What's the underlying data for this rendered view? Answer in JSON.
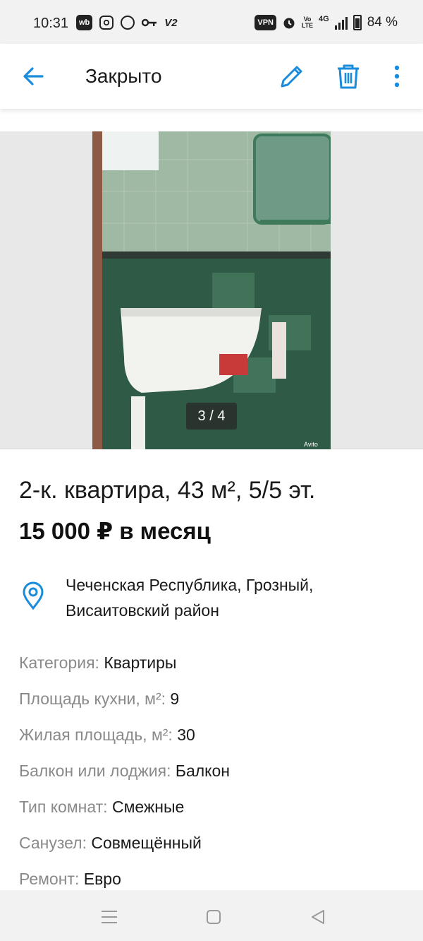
{
  "status_bar": {
    "time": "10:31",
    "left_icons": [
      "wb",
      "instagram-icon",
      "circle-icon",
      "key-icon",
      "V2"
    ],
    "right_icons": [
      "VPN",
      "alarm-icon",
      "Vo LTE",
      "4G",
      "signal-icon",
      "battery-icon"
    ],
    "vpn": "VPN",
    "battery": "84 %",
    "wb": "wb",
    "v2": "V2",
    "volte": "Vo LTE",
    "net": "4G"
  },
  "app_bar": {
    "title": "Закрыто",
    "accent": "#1a8cdb",
    "icons": [
      "back-arrow-icon",
      "pencil-icon",
      "trash-icon",
      "more-vert-icon"
    ]
  },
  "gallery": {
    "counter": "3 / 4",
    "watermark": "Avito"
  },
  "listing": {
    "title": "2-к. квартира, 43 м², 5/5 эт.",
    "price": "15 000 ₽ в месяц",
    "address": "Чеченская Республика, Грозный, Висаитовский район"
  },
  "attributes": [
    {
      "key": "Категория:",
      "value": "Квартиры"
    },
    {
      "key": "Площадь кухни, м²:",
      "value": "9"
    },
    {
      "key": "Жилая площадь, м²:",
      "value": "30"
    },
    {
      "key": "Балкон или лоджия:",
      "value": "Балкон"
    },
    {
      "key": "Тип комнат:",
      "value": "Смежные"
    },
    {
      "key": "Санузел:",
      "value": "Совмещённый"
    },
    {
      "key": "Ремонт:",
      "value": "Евро"
    }
  ],
  "nav_bar": {
    "icons": [
      "menu-icon",
      "home-square-icon",
      "back-triangle-icon"
    ]
  }
}
